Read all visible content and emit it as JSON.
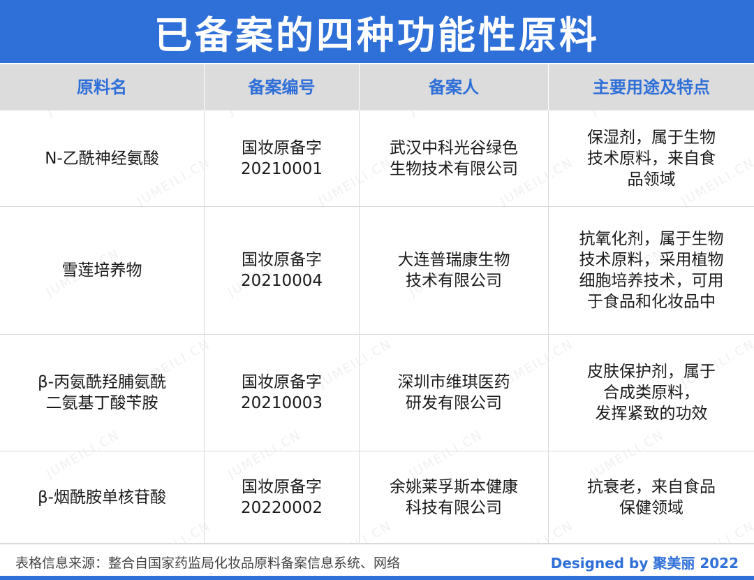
{
  "title": "已备案的四种功能性原料",
  "table": {
    "headers": [
      "原料名",
      "备案编号",
      "备案人",
      "主要用途及特点"
    ],
    "rows": [
      {
        "name": "N-乙酰神经氨酸",
        "record_no": "国妆原备字\n20210001",
        "filer": "武汉中科光谷绿色\n生物技术有限公司",
        "usage": "保湿剂，属于生物\n技术原料，来自食\n品领域"
      },
      {
        "name": "雪莲培养物",
        "record_no": "国妆原备字\n20210004",
        "filer": "大连普瑞康生物\n技术有限公司",
        "usage": "抗氧化剂，属于生物\n技术原料，采用植物\n细胞培养技术，可用\n于食品和化妆品中"
      },
      {
        "name": "β-丙氨酰羟脯氨酰\n二氨基丁酸苄胺",
        "record_no": "国妆原备字\n20210003",
        "filer": "深圳市维琪医药\n研发有限公司",
        "usage": "皮肤保护剂，属于\n合成类原料，\n发挥紧致的功效"
      },
      {
        "name": "β-烟酰胺单核苷酸",
        "record_no": "国妆原备字\n20220002",
        "filer": "余姚莱孚斯本健康\n科技有限公司",
        "usage": "抗衰老，来自食品\n保健领域"
      }
    ]
  },
  "footer": {
    "source": "表格信息来源：整合自国家药监局化妆品原料备案信息系统、网络",
    "credit": "Designed by 聚美丽 2022"
  },
  "watermark": "JUMEILI.CN",
  "colors": {
    "accent": "#2f6fd8",
    "header_bg": "#dcdcdc"
  }
}
